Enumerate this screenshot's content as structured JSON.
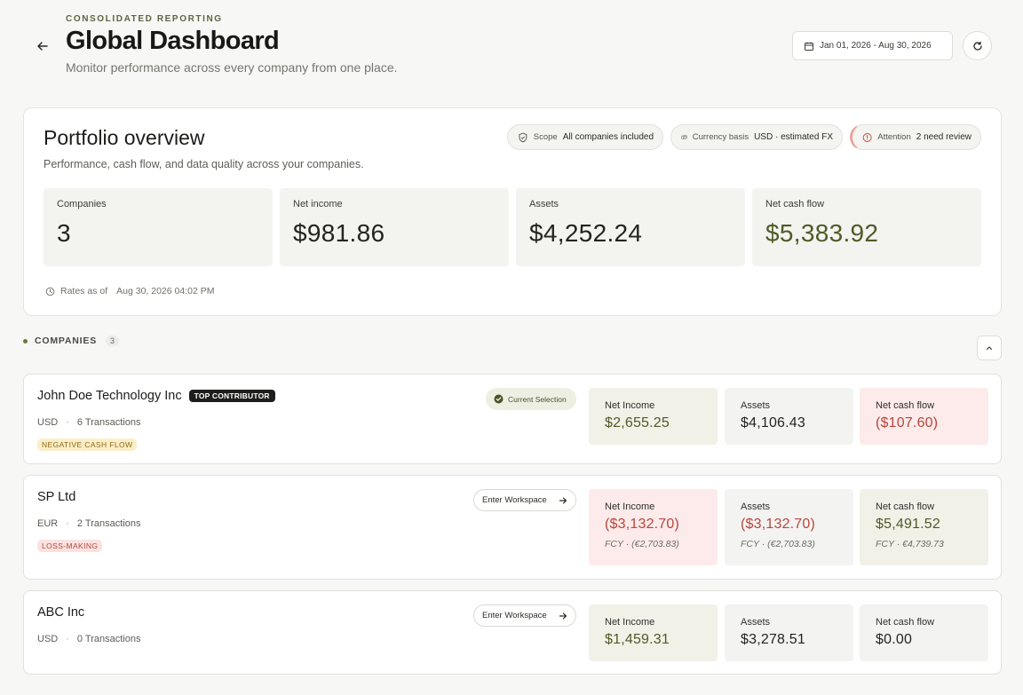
{
  "header": {
    "eyebrow": "CONSOLIDATED REPORTING",
    "title": "Global Dashboard",
    "subtitle": "Monitor performance across every company from one place.",
    "date_range": "Jan 01, 2026 - Aug 30, 2026"
  },
  "portfolio": {
    "title": "Portfolio overview",
    "subtitle": "Performance, cash flow, and data quality across your companies.",
    "pills": {
      "scope_label": "Scope",
      "scope_value": "All companies included",
      "currency_label": "Currency basis",
      "currency_value": "USD · estimated FX",
      "attention_label": "Attention",
      "attention_value": "2 need review"
    },
    "stats": [
      {
        "label": "Companies",
        "value": "3"
      },
      {
        "label": "Net income",
        "value": "$981.86"
      },
      {
        "label": "Assets",
        "value": "$4,252.24"
      },
      {
        "label": "Net cash flow",
        "value": "$5,383.92"
      }
    ],
    "rates_label": "Rates as of",
    "rates_time": "Aug 30, 2026 04:02 PM"
  },
  "companies_section": {
    "label": "COMPANIES",
    "count": "3"
  },
  "companies": [
    {
      "name": "John Doe Technology Inc",
      "badge": "TOP CONTRIBUTOR",
      "currency": "USD",
      "transactions": "6 Transactions",
      "tag": "NEGATIVE CASH FLOW",
      "action": "Current Selection",
      "metrics": [
        {
          "label": "Net Income",
          "value": "$2,655.25"
        },
        {
          "label": "Assets",
          "value": "$4,106.43"
        },
        {
          "label": "Net cash flow",
          "value": "($107.60)"
        }
      ]
    },
    {
      "name": "SP Ltd",
      "currency": "EUR",
      "transactions": "2 Transactions",
      "tag": "LOSS-MAKING",
      "action": "Enter Workspace",
      "metrics": [
        {
          "label": "Net Income",
          "value": "($3,132.70)",
          "fcy": "FCY · (€2,703.83)"
        },
        {
          "label": "Assets",
          "value": "($3,132.70)",
          "fcy": "FCY · (€2,703.83)"
        },
        {
          "label": "Net cash flow",
          "value": "$5,491.52",
          "fcy": "FCY · €4,739.73"
        }
      ]
    },
    {
      "name": "ABC Inc",
      "currency": "USD",
      "transactions": "0 Transactions",
      "action": "Enter Workspace",
      "metrics": [
        {
          "label": "Net Income",
          "value": "$1,459.31"
        },
        {
          "label": "Assets",
          "value": "$3,278.51"
        },
        {
          "label": "Net cash flow",
          "value": "$0.00"
        }
      ]
    }
  ],
  "colors": {
    "accent_green": "#4f5a26",
    "negative_red": "#b8453b",
    "warn_tag_bg": "#fbeec7",
    "loss_tag_bg": "#fbe2df"
  },
  "icons": {
    "back": "arrow-left-icon",
    "calendar": "calendar-icon",
    "refresh": "refresh-icon",
    "scope": "shield-icon",
    "currency": "banknote-icon",
    "attention": "alert-circle-icon",
    "clock": "clock-icon",
    "check": "check-circle-icon",
    "arrow_right": "arrow-right-icon",
    "collapse": "chevron-up-icon"
  }
}
